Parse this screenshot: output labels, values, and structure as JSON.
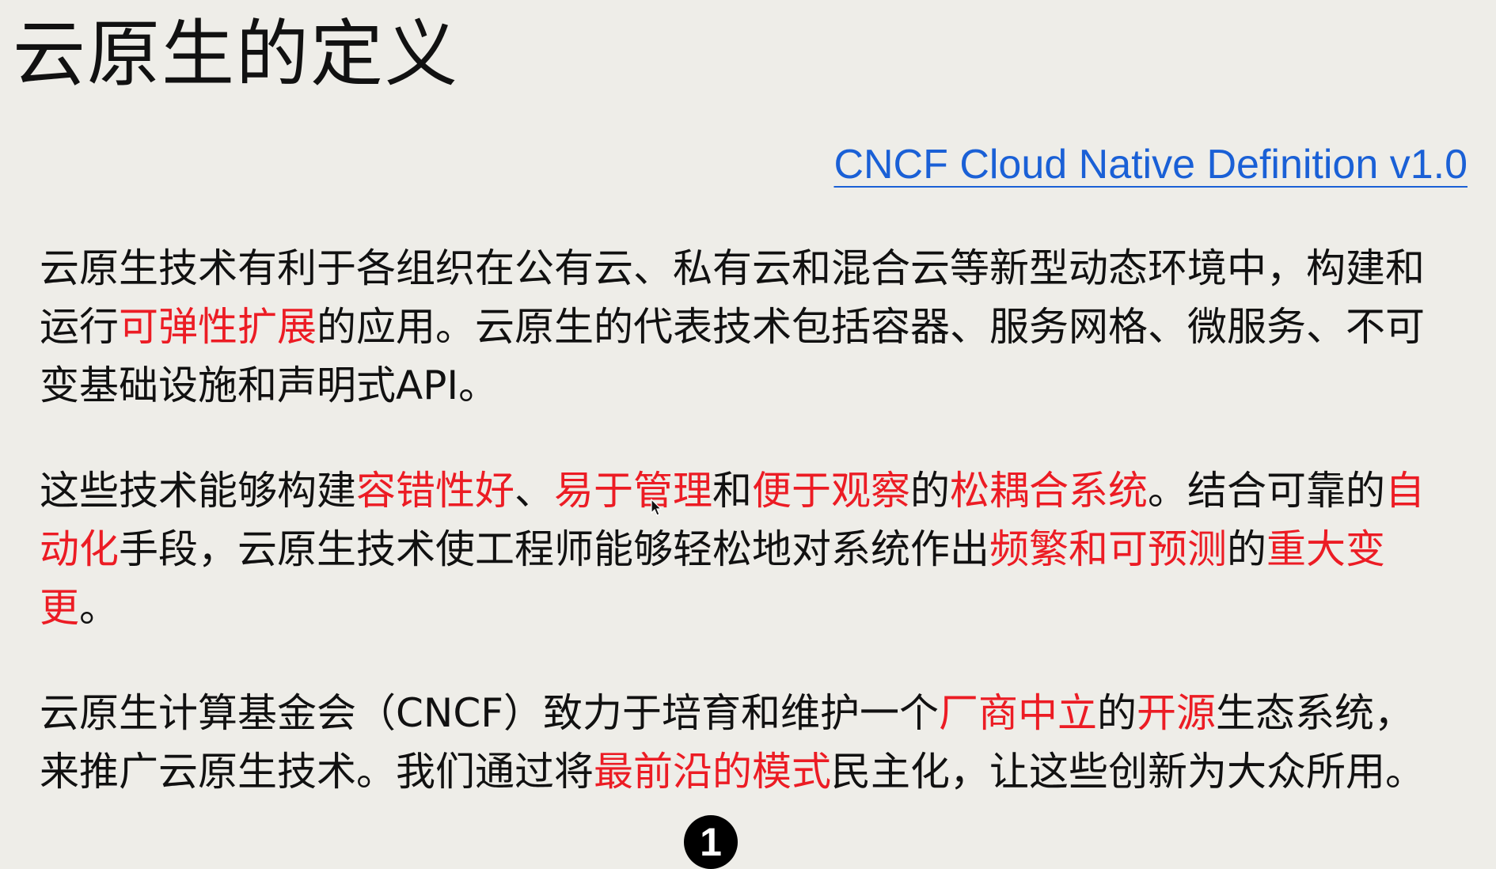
{
  "title": "云原生的定义",
  "source_link": "CNCF Cloud Native Definition v1.0",
  "paragraphs": [
    [
      {
        "text": "云原生技术有利于各组织在公有云、私有云和混合云等新型动态环境中，构建和运行",
        "highlight": false
      },
      {
        "text": "可弹性扩展",
        "highlight": true
      },
      {
        "text": "的应用。云原生的代表技术包括容器、服务网格、微服务、不可变基础设施和声明式API。",
        "highlight": false
      }
    ],
    [
      {
        "text": "这些技术能够构建",
        "highlight": false
      },
      {
        "text": "容错性好",
        "highlight": true
      },
      {
        "text": "、",
        "highlight": false
      },
      {
        "text": "易于管理",
        "highlight": true
      },
      {
        "text": "和",
        "highlight": false
      },
      {
        "text": "便于观察",
        "highlight": true
      },
      {
        "text": "的",
        "highlight": false
      },
      {
        "text": "松耦合系统",
        "highlight": true
      },
      {
        "text": "。结合可靠的",
        "highlight": false
      },
      {
        "text": "自动化",
        "highlight": true
      },
      {
        "text": "手段，云原生技术使工程师能够轻松地对系统作出",
        "highlight": false
      },
      {
        "text": "频繁和可预测",
        "highlight": true
      },
      {
        "text": "的",
        "highlight": false
      },
      {
        "text": "重大变更",
        "highlight": true
      },
      {
        "text": "。",
        "highlight": false
      }
    ],
    [
      {
        "text": "云原生计算基金会（CNCF）致力于培育和维护一个",
        "highlight": false
      },
      {
        "text": "厂商中立",
        "highlight": true
      },
      {
        "text": "的",
        "highlight": false
      },
      {
        "text": "开源",
        "highlight": true
      },
      {
        "text": "生态系统，来推广云原生技术。我们通过将",
        "highlight": false
      },
      {
        "text": "最前沿的模式",
        "highlight": true
      },
      {
        "text": "民主化，让这些创新为大众所用。",
        "highlight": false
      }
    ]
  ],
  "page_number": "1",
  "colors": {
    "background": "#eeede8",
    "text": "#111111",
    "highlight": "#ec1c24",
    "link": "#1a60d6"
  }
}
